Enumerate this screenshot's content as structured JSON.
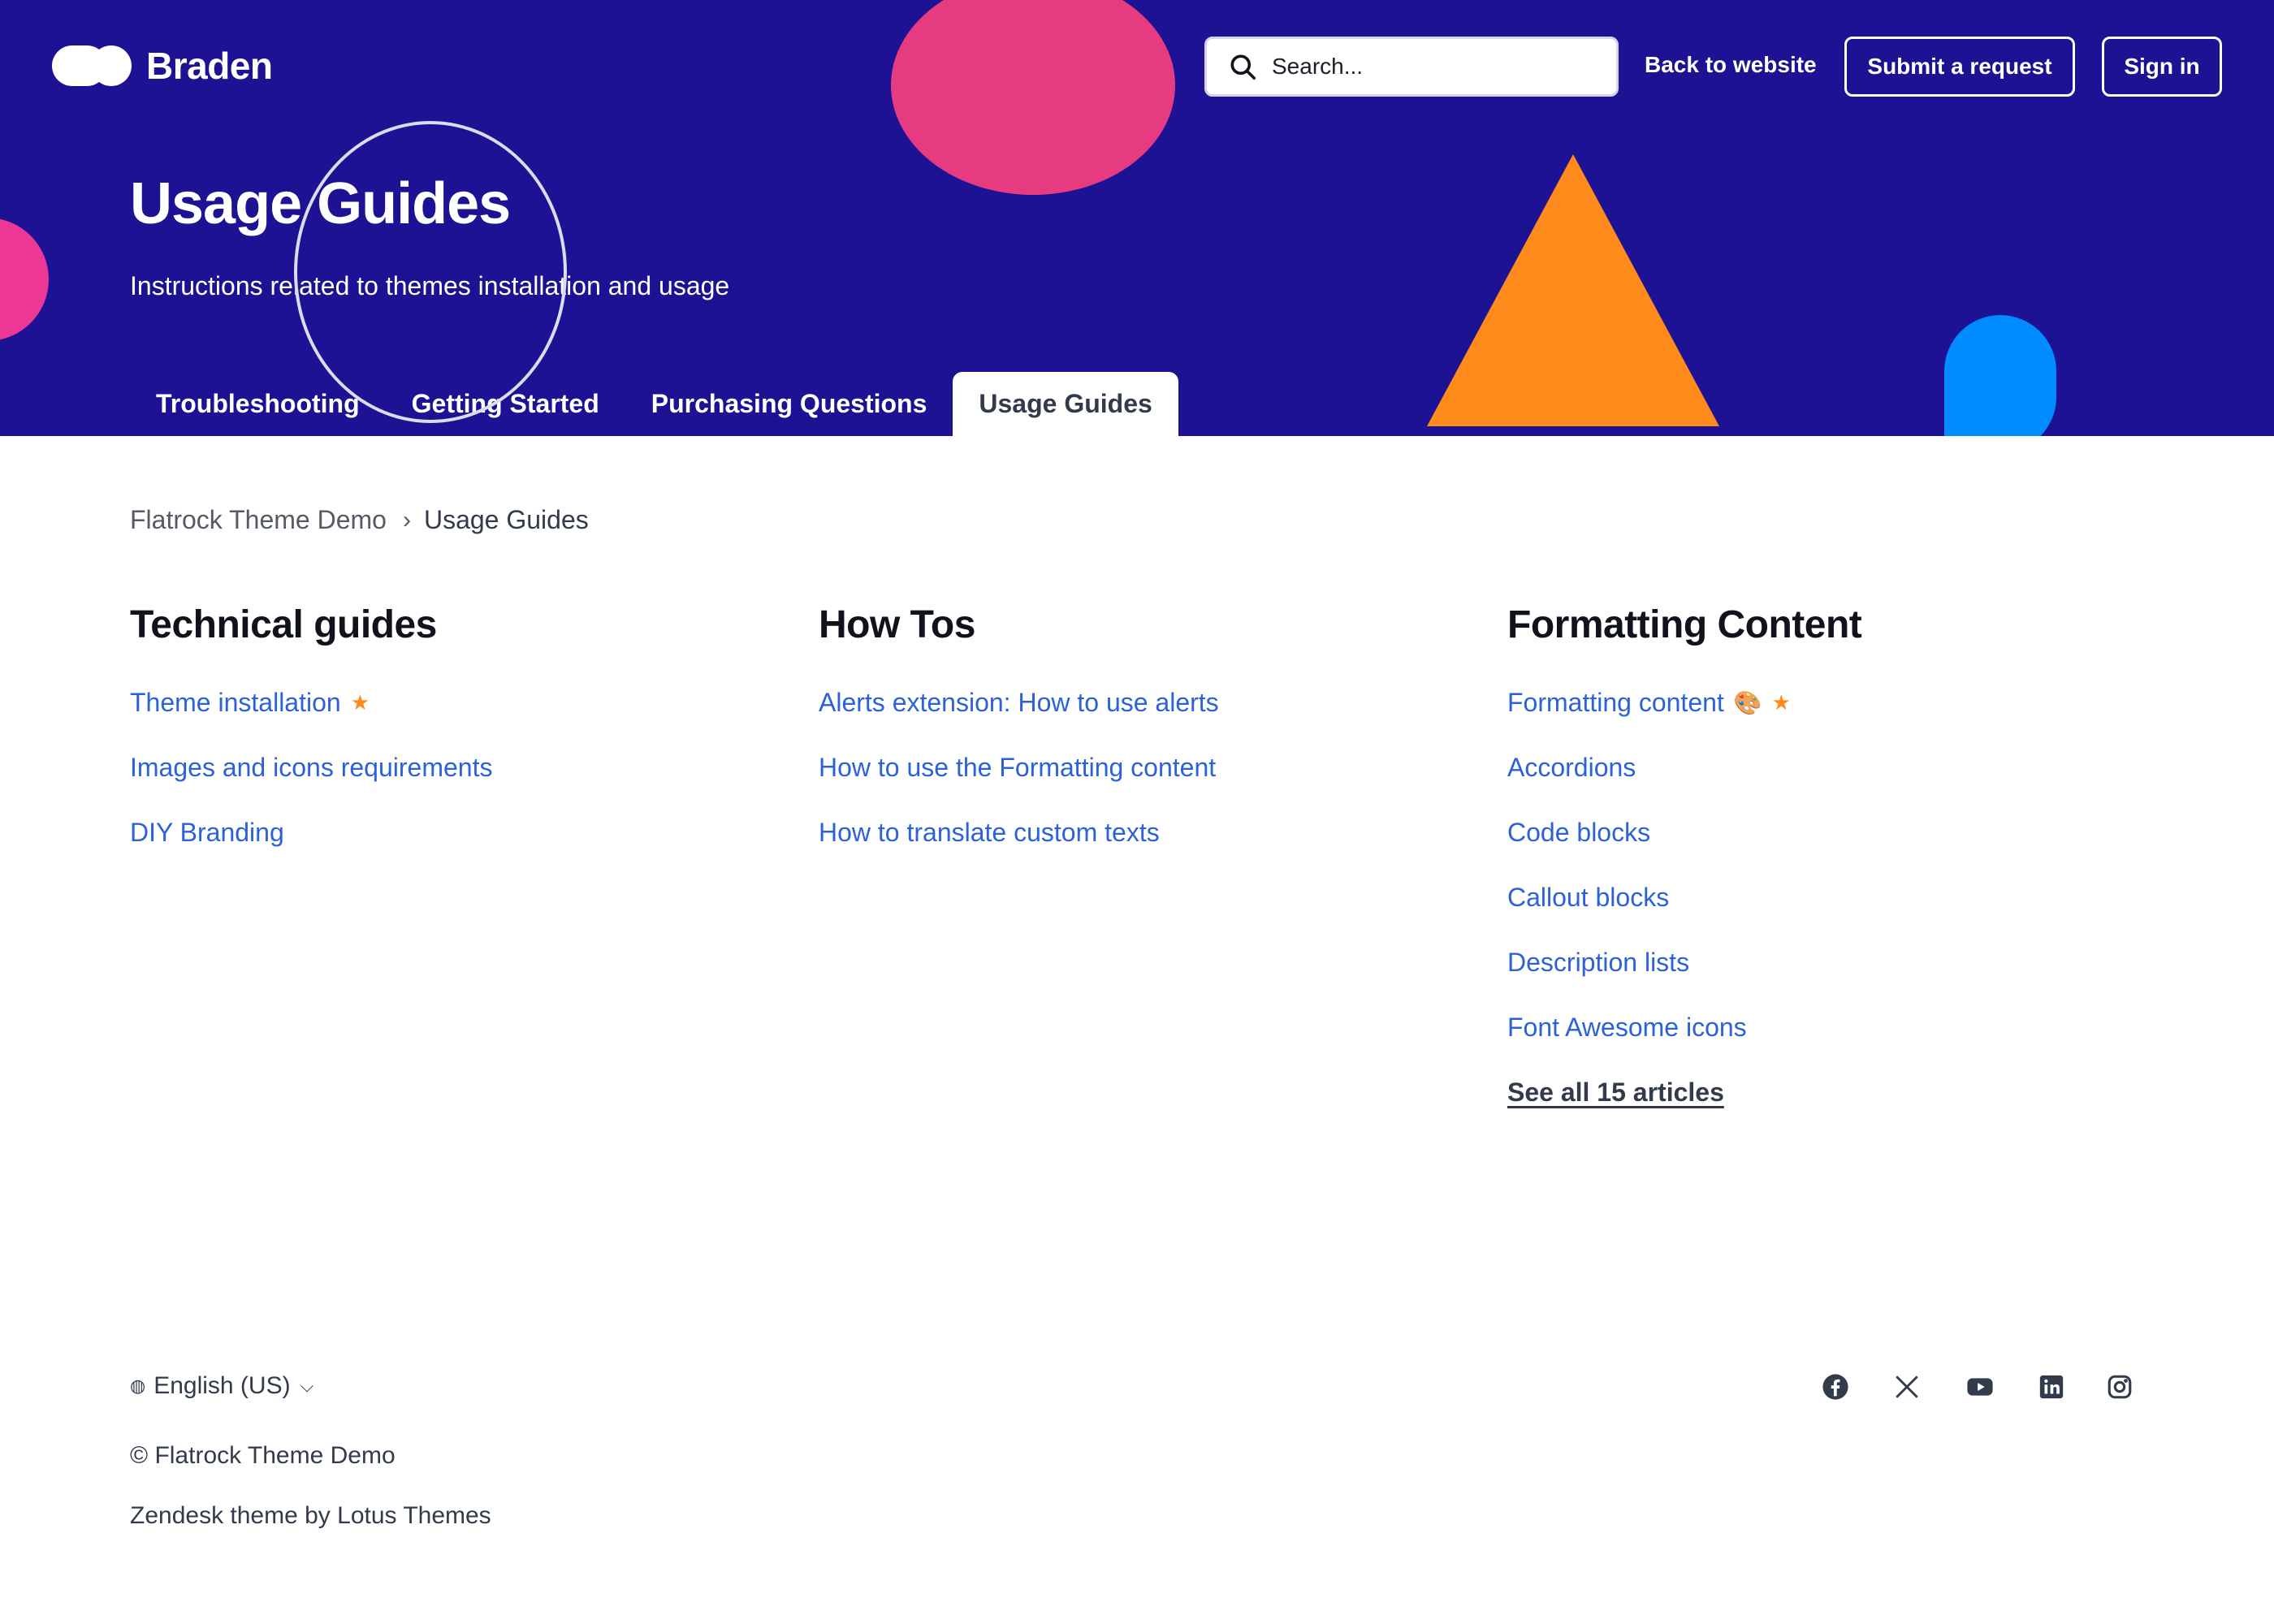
{
  "header": {
    "brand": "Braden",
    "search_placeholder": "Search...",
    "back_to_website": "Back to website",
    "submit_request": "Submit a request",
    "sign_in": "Sign in"
  },
  "hero": {
    "title": "Usage Guides",
    "subtitle": "Instructions related to themes installation and usage"
  },
  "tabs": [
    {
      "label": "Troubleshooting",
      "active": false
    },
    {
      "label": "Getting Started",
      "active": false
    },
    {
      "label": "Purchasing Questions",
      "active": false
    },
    {
      "label": "Usage Guides",
      "active": true
    }
  ],
  "breadcrumb": [
    "Flatrock Theme Demo",
    "Usage Guides"
  ],
  "sections": [
    {
      "title": "Technical guides",
      "articles": [
        {
          "label": "Theme installation",
          "starred": true
        },
        {
          "label": "Images and icons requirements"
        },
        {
          "label": "DIY Branding"
        }
      ]
    },
    {
      "title": "How Tos",
      "articles": [
        {
          "label": "Alerts extension: How to use alerts"
        },
        {
          "label": "How to use the Formatting content"
        },
        {
          "label": "How to translate custom texts"
        }
      ]
    },
    {
      "title": "Formatting Content",
      "articles": [
        {
          "label": "Formatting content",
          "starred": true,
          "emoji": "🎨"
        },
        {
          "label": "Accordions"
        },
        {
          "label": "Code blocks"
        },
        {
          "label": "Callout blocks"
        },
        {
          "label": "Description lists"
        },
        {
          "label": "Font Awesome icons"
        }
      ],
      "see_all": "See all 15 articles"
    }
  ],
  "footer": {
    "language": "English (US)",
    "copyright": "© Flatrock Theme Demo",
    "credit": "Zendesk theme by Lotus Themes",
    "social_icons": [
      "facebook-icon",
      "x-icon",
      "youtube-icon",
      "linkedin-icon",
      "instagram-icon"
    ]
  },
  "colors": {
    "hero_bg": "#1e1294",
    "link": "#2b61d9",
    "accent_orange": "#fe8b1b",
    "accent_pink": "#e63b81",
    "accent_blue": "#008cff"
  }
}
